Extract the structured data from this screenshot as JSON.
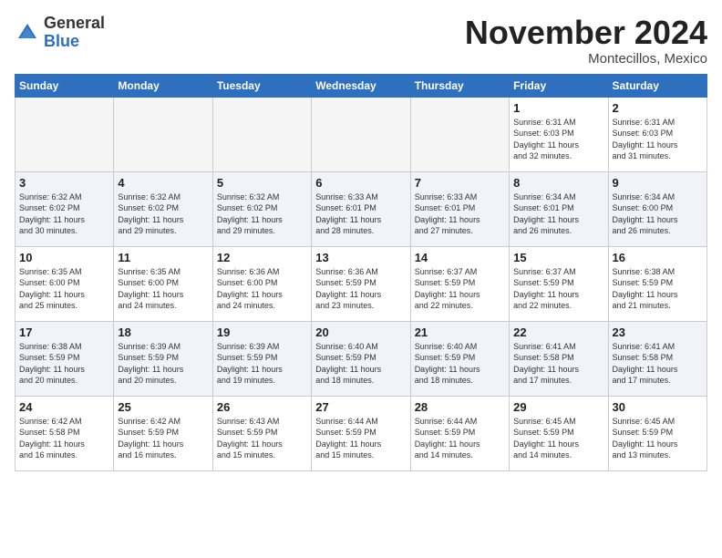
{
  "header": {
    "logo_general": "General",
    "logo_blue": "Blue",
    "month_title": "November 2024",
    "location": "Montecillos, Mexico"
  },
  "days_of_week": [
    "Sunday",
    "Monday",
    "Tuesday",
    "Wednesday",
    "Thursday",
    "Friday",
    "Saturday"
  ],
  "weeks": [
    [
      {
        "day": "",
        "info": "",
        "empty": true
      },
      {
        "day": "",
        "info": "",
        "empty": true
      },
      {
        "day": "",
        "info": "",
        "empty": true
      },
      {
        "day": "",
        "info": "",
        "empty": true
      },
      {
        "day": "",
        "info": "",
        "empty": true
      },
      {
        "day": "1",
        "info": "Sunrise: 6:31 AM\nSunset: 6:03 PM\nDaylight: 11 hours\nand 32 minutes.",
        "empty": false
      },
      {
        "day": "2",
        "info": "Sunrise: 6:31 AM\nSunset: 6:03 PM\nDaylight: 11 hours\nand 31 minutes.",
        "empty": false
      }
    ],
    [
      {
        "day": "3",
        "info": "Sunrise: 6:32 AM\nSunset: 6:02 PM\nDaylight: 11 hours\nand 30 minutes.",
        "empty": false
      },
      {
        "day": "4",
        "info": "Sunrise: 6:32 AM\nSunset: 6:02 PM\nDaylight: 11 hours\nand 29 minutes.",
        "empty": false
      },
      {
        "day": "5",
        "info": "Sunrise: 6:32 AM\nSunset: 6:02 PM\nDaylight: 11 hours\nand 29 minutes.",
        "empty": false
      },
      {
        "day": "6",
        "info": "Sunrise: 6:33 AM\nSunset: 6:01 PM\nDaylight: 11 hours\nand 28 minutes.",
        "empty": false
      },
      {
        "day": "7",
        "info": "Sunrise: 6:33 AM\nSunset: 6:01 PM\nDaylight: 11 hours\nand 27 minutes.",
        "empty": false
      },
      {
        "day": "8",
        "info": "Sunrise: 6:34 AM\nSunset: 6:01 PM\nDaylight: 11 hours\nand 26 minutes.",
        "empty": false
      },
      {
        "day": "9",
        "info": "Sunrise: 6:34 AM\nSunset: 6:00 PM\nDaylight: 11 hours\nand 26 minutes.",
        "empty": false
      }
    ],
    [
      {
        "day": "10",
        "info": "Sunrise: 6:35 AM\nSunset: 6:00 PM\nDaylight: 11 hours\nand 25 minutes.",
        "empty": false
      },
      {
        "day": "11",
        "info": "Sunrise: 6:35 AM\nSunset: 6:00 PM\nDaylight: 11 hours\nand 24 minutes.",
        "empty": false
      },
      {
        "day": "12",
        "info": "Sunrise: 6:36 AM\nSunset: 6:00 PM\nDaylight: 11 hours\nand 24 minutes.",
        "empty": false
      },
      {
        "day": "13",
        "info": "Sunrise: 6:36 AM\nSunset: 5:59 PM\nDaylight: 11 hours\nand 23 minutes.",
        "empty": false
      },
      {
        "day": "14",
        "info": "Sunrise: 6:37 AM\nSunset: 5:59 PM\nDaylight: 11 hours\nand 22 minutes.",
        "empty": false
      },
      {
        "day": "15",
        "info": "Sunrise: 6:37 AM\nSunset: 5:59 PM\nDaylight: 11 hours\nand 22 minutes.",
        "empty": false
      },
      {
        "day": "16",
        "info": "Sunrise: 6:38 AM\nSunset: 5:59 PM\nDaylight: 11 hours\nand 21 minutes.",
        "empty": false
      }
    ],
    [
      {
        "day": "17",
        "info": "Sunrise: 6:38 AM\nSunset: 5:59 PM\nDaylight: 11 hours\nand 20 minutes.",
        "empty": false
      },
      {
        "day": "18",
        "info": "Sunrise: 6:39 AM\nSunset: 5:59 PM\nDaylight: 11 hours\nand 20 minutes.",
        "empty": false
      },
      {
        "day": "19",
        "info": "Sunrise: 6:39 AM\nSunset: 5:59 PM\nDaylight: 11 hours\nand 19 minutes.",
        "empty": false
      },
      {
        "day": "20",
        "info": "Sunrise: 6:40 AM\nSunset: 5:59 PM\nDaylight: 11 hours\nand 18 minutes.",
        "empty": false
      },
      {
        "day": "21",
        "info": "Sunrise: 6:40 AM\nSunset: 5:59 PM\nDaylight: 11 hours\nand 18 minutes.",
        "empty": false
      },
      {
        "day": "22",
        "info": "Sunrise: 6:41 AM\nSunset: 5:58 PM\nDaylight: 11 hours\nand 17 minutes.",
        "empty": false
      },
      {
        "day": "23",
        "info": "Sunrise: 6:41 AM\nSunset: 5:58 PM\nDaylight: 11 hours\nand 17 minutes.",
        "empty": false
      }
    ],
    [
      {
        "day": "24",
        "info": "Sunrise: 6:42 AM\nSunset: 5:58 PM\nDaylight: 11 hours\nand 16 minutes.",
        "empty": false
      },
      {
        "day": "25",
        "info": "Sunrise: 6:42 AM\nSunset: 5:59 PM\nDaylight: 11 hours\nand 16 minutes.",
        "empty": false
      },
      {
        "day": "26",
        "info": "Sunrise: 6:43 AM\nSunset: 5:59 PM\nDaylight: 11 hours\nand 15 minutes.",
        "empty": false
      },
      {
        "day": "27",
        "info": "Sunrise: 6:44 AM\nSunset: 5:59 PM\nDaylight: 11 hours\nand 15 minutes.",
        "empty": false
      },
      {
        "day": "28",
        "info": "Sunrise: 6:44 AM\nSunset: 5:59 PM\nDaylight: 11 hours\nand 14 minutes.",
        "empty": false
      },
      {
        "day": "29",
        "info": "Sunrise: 6:45 AM\nSunset: 5:59 PM\nDaylight: 11 hours\nand 14 minutes.",
        "empty": false
      },
      {
        "day": "30",
        "info": "Sunrise: 6:45 AM\nSunset: 5:59 PM\nDaylight: 11 hours\nand 13 minutes.",
        "empty": false
      }
    ]
  ]
}
